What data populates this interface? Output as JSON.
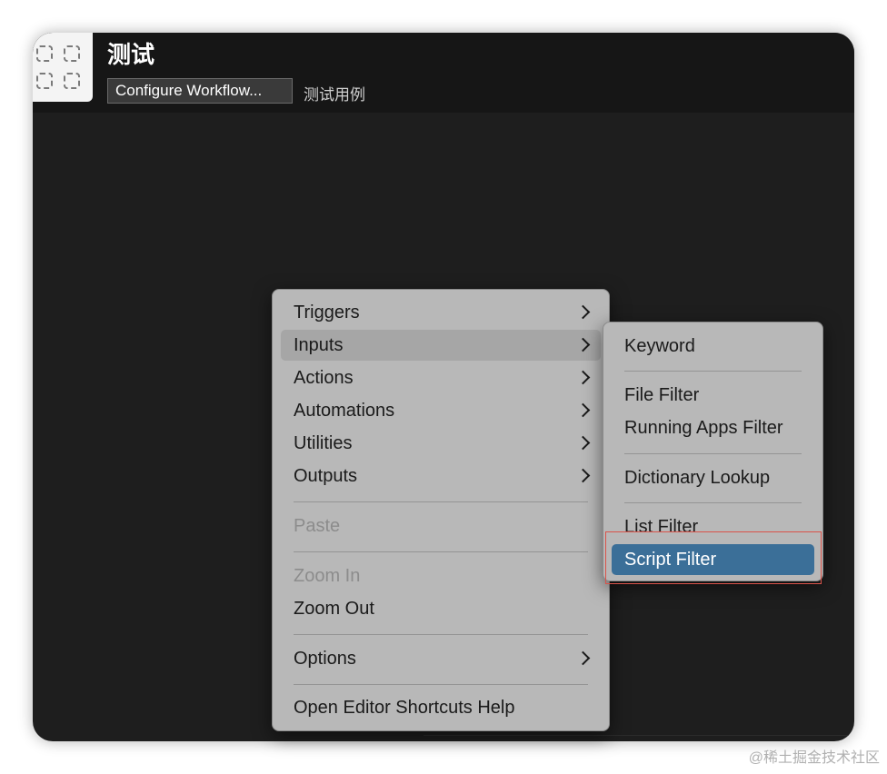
{
  "header": {
    "title": "测试",
    "configure_button": "Configure Workflow...",
    "subtitle": "测试用例"
  },
  "main_menu": {
    "items": [
      {
        "label": "Triggers",
        "submenu": true
      },
      {
        "label": "Inputs",
        "submenu": true,
        "state": "hover"
      },
      {
        "label": "Actions",
        "submenu": true
      },
      {
        "label": "Automations",
        "submenu": true
      },
      {
        "label": "Utilities",
        "submenu": true
      },
      {
        "label": "Outputs",
        "submenu": true
      },
      {
        "label": "Paste",
        "disabled": true
      },
      {
        "label": "Zoom In",
        "disabled": true
      },
      {
        "label": "Zoom Out"
      },
      {
        "label": "Options",
        "submenu": true
      },
      {
        "label": "Open Editor Shortcuts Help"
      }
    ]
  },
  "sub_menu": {
    "items": [
      {
        "label": "Keyword"
      },
      {
        "label": "File Filter"
      },
      {
        "label": "Running Apps Filter"
      },
      {
        "label": "Dictionary Lookup"
      },
      {
        "label": "List Filter"
      },
      {
        "label": "Script Filter",
        "state": "selected"
      }
    ]
  },
  "watermark": "@稀土掘金技术社区",
  "colors": {
    "window_bg": "#1e1e1e",
    "menu_bg": "#b8b8b8",
    "selection": "#3b6f98",
    "annotation_box": "#d9534a"
  }
}
